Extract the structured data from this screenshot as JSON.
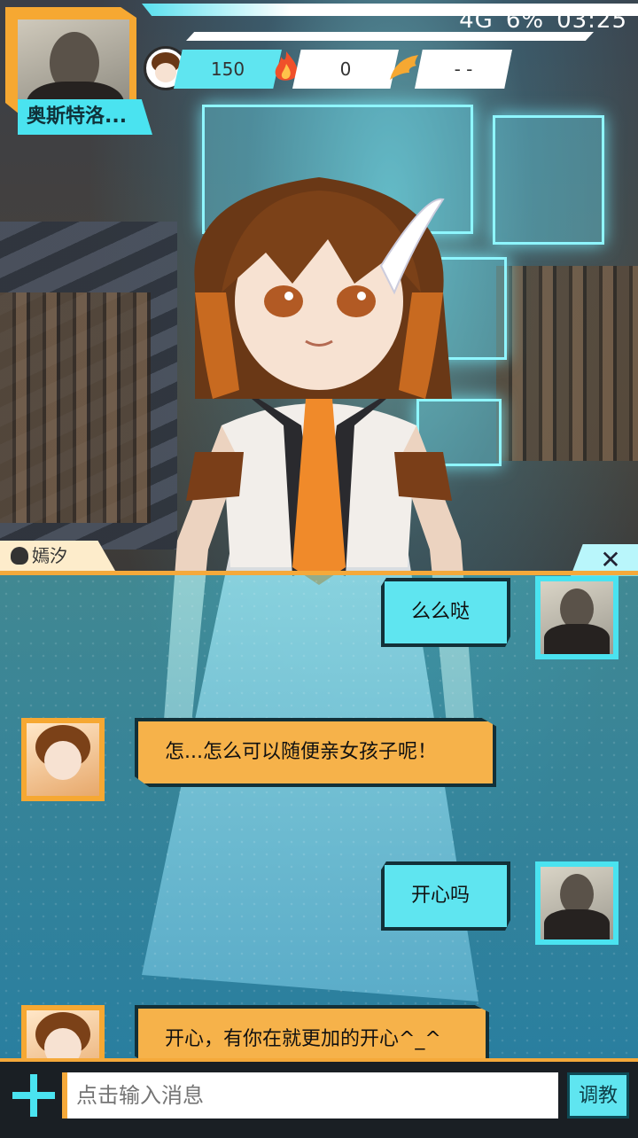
{
  "status_bar": {
    "battery": "6%",
    "time": "03:25",
    "network": "4G"
  },
  "hud": {
    "player_name": "奥斯特洛...",
    "stats": {
      "coins": "150",
      "fire_count": "0",
      "wing_value": "- -"
    }
  },
  "dialog": {
    "speaker_name": "嫣汐",
    "close_label": "✕"
  },
  "messages": [
    {
      "from": "me",
      "text": "么么哒"
    },
    {
      "from": "her",
      "text": "怎...怎么可以随便亲女孩子呢！"
    },
    {
      "from": "me",
      "text": "开心吗"
    },
    {
      "from": "her",
      "text": "开心，有你在就更加的开心^_^"
    }
  ],
  "input": {
    "placeholder": "点击输入消息",
    "train_label": "调教"
  },
  "colors": {
    "accent_cyan": "#4ae3f0",
    "accent_orange": "#f5a93a"
  }
}
